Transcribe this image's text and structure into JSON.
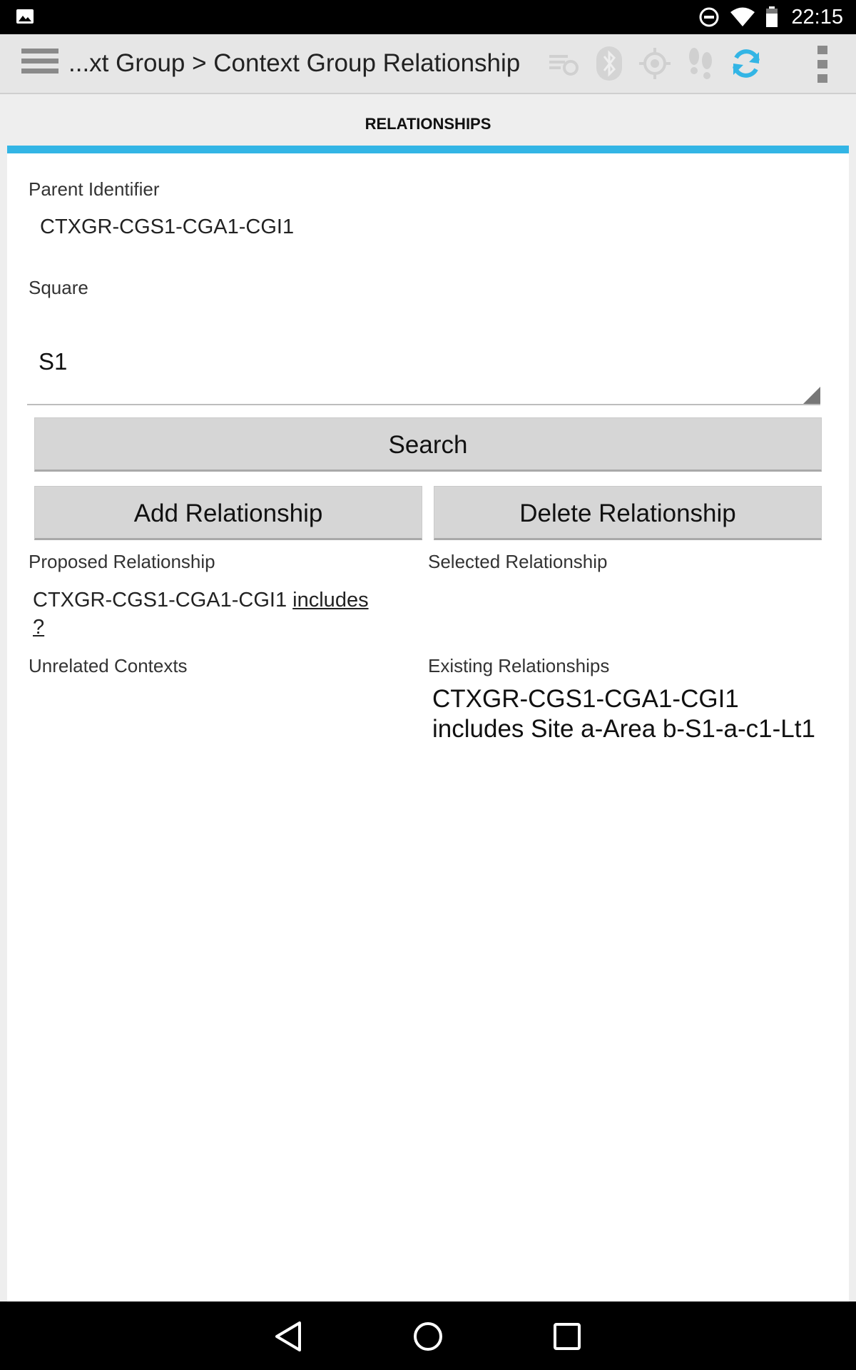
{
  "status_bar": {
    "time": "22:15",
    "icons": [
      "gallery-icon",
      "do-not-disturb-icon",
      "wifi-icon",
      "battery-icon"
    ]
  },
  "action_bar": {
    "title": "...xt Group > Context Group Relationship",
    "icons": [
      "menu-icon",
      "sync-settings-icon",
      "bluetooth-icon",
      "gps-icon",
      "footprints-icon",
      "refresh-icon",
      "overflow-icon"
    ],
    "accent_color": "#33b5e5"
  },
  "tabs": {
    "active_label": "RELATIONSHIPS"
  },
  "form": {
    "parent_identifier_label": "Parent Identifier",
    "parent_identifier_value": "CTXGR-CGS1-CGA1-CGI1",
    "square_label": "Square",
    "square_value": "S1",
    "search_button": "Search",
    "add_button": "Add Relationship",
    "delete_button": "Delete Relationship"
  },
  "relationships": {
    "proposed_label": "Proposed Relationship",
    "proposed_parent": "CTXGR-CGS1-CGA1-CGI1",
    "proposed_verb": " includes ",
    "proposed_child": " ? ",
    "selected_label": "Selected Relationship",
    "selected_value": "",
    "unrelated_label": "Unrelated Contexts",
    "existing_label": "Existing Relationships",
    "existing_items": [
      "CTXGR-CGS1-CGA1-CGI1 includes Site a-Area b-S1-a-c1-Lt1"
    ]
  },
  "nav_bar": {
    "icons": [
      "back-icon",
      "home-icon",
      "recents-icon"
    ]
  }
}
